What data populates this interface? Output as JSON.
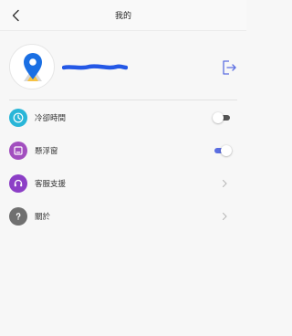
{
  "header": {
    "title": "我的",
    "back_icon": "chevron-left-icon"
  },
  "profile": {
    "avatar_icon": "map-pin-icon",
    "username": "",
    "logout_icon": "logout-icon"
  },
  "menu": [
    {
      "label": "冷卻時間",
      "icon": "clock-icon",
      "icon_color": "#29b6d8",
      "control": "toggle",
      "toggle_on": false
    },
    {
      "label": "懸浮窗",
      "icon": "floating-window-icon",
      "icon_color": "#a24fbf",
      "control": "toggle",
      "toggle_on": true
    },
    {
      "label": "客服支援",
      "icon": "headset-icon",
      "icon_color": "#8c3fc6",
      "control": "chevron"
    },
    {
      "label": "關於",
      "icon": "question-icon",
      "icon_color": "#707070",
      "control": "chevron"
    }
  ],
  "colors": {
    "accent": "#5b6ee1",
    "toggle_off": "#555555"
  }
}
